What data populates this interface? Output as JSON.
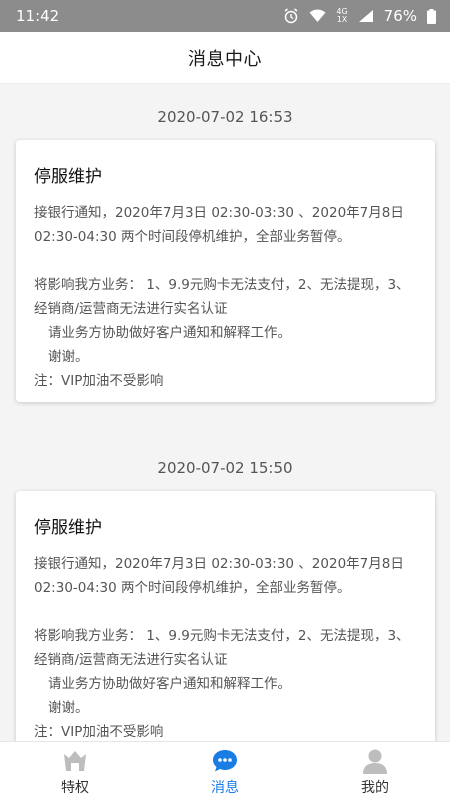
{
  "status_bar": {
    "time": "11:42",
    "network_top": "4G",
    "network_bottom": "1X",
    "battery": "76%"
  },
  "header": {
    "title": "消息中心"
  },
  "messages": [
    {
      "time": "2020-07-02 16:53",
      "title": "停服维护",
      "line1": "接银行通知，2020年7月3日 02:30-03:30 、2020年7月8日 02:30-04:30 两个时间段停机维护，全部业务暂停。",
      "line2": "将影响我方业务： 1、9.9元购卡无法支付，2、无法提现，3、经销商/运营商无法进行实名认证",
      "line3": "请业务方协助做好客户通知和解释工作。",
      "line4": "谢谢。",
      "line5": "注：VIP加油不受影响"
    },
    {
      "time": "2020-07-02 15:50",
      "title": "停服维护",
      "line1": "接银行通知，2020年7月3日 02:30-03:30 、2020年7月8日 02:30-04:30 两个时间段停机维护，全部业务暂停。",
      "line2": "将影响我方业务： 1、9.9元购卡无法支付，2、无法提现，3、经销商/运营商无法进行实名认证",
      "line3": "请业务方协助做好客户通知和解释工作。",
      "line4": "谢谢。",
      "line5": "注：VIP加油不受影响"
    }
  ],
  "tabbar": {
    "tabs": [
      {
        "label": "特权",
        "icon": "crown-icon"
      },
      {
        "label": "消息",
        "icon": "chat-bubble-icon"
      },
      {
        "label": "我的",
        "icon": "person-icon"
      }
    ],
    "active_color": "#1a7de4",
    "inactive_icon_color": "#bdbdbd"
  }
}
